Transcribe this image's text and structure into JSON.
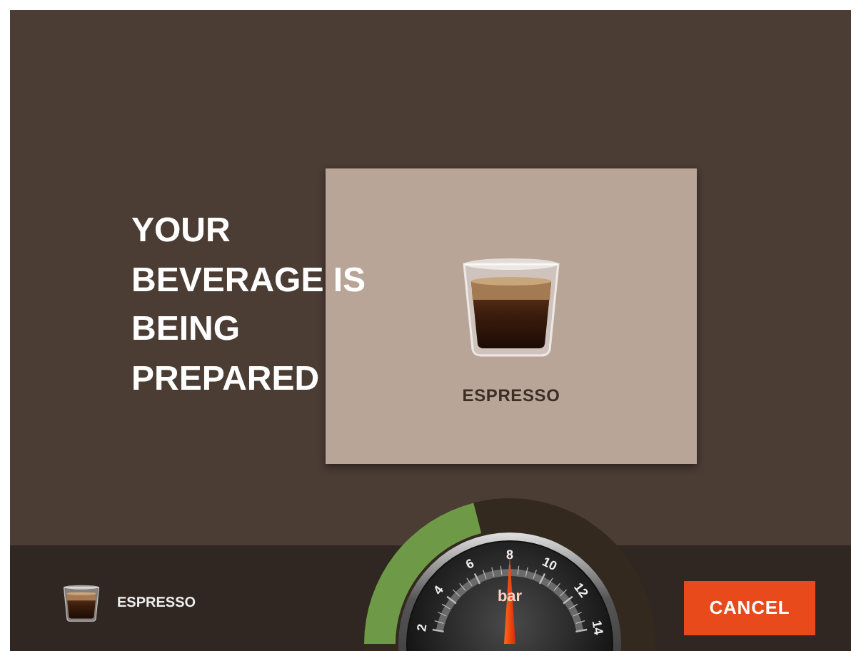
{
  "status_message": "YOUR BEVERAGE IS BEING PREPARED",
  "beverage_card": {
    "name": "ESPRESSO"
  },
  "progress_ring": {
    "level": 0.42
  },
  "pressure_gauge": {
    "unit": "bar",
    "level": 0.5,
    "tick_labels": [
      "2",
      "4",
      "6",
      "8",
      "10",
      "12",
      "14"
    ]
  },
  "bottom_bar": {
    "beverage": "ESPRESSO",
    "cancel_button": "CANCEL"
  }
}
